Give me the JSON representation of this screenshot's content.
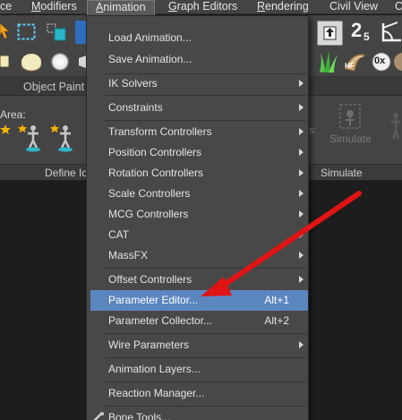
{
  "menubar": {
    "items": [
      {
        "label": "ce"
      },
      {
        "label": "Modifiers",
        "mnemonic": "M",
        "rest": "odifiers"
      },
      {
        "label": "Animation",
        "mnemonic": "A",
        "rest": "nimation"
      },
      {
        "label": "Graph Editors",
        "mnemonic": "G",
        "rest": "raph Editors"
      },
      {
        "label": "Rendering",
        "mnemonic": "R",
        "rest": "endering"
      },
      {
        "label": "Civil View"
      },
      {
        "label": "C"
      }
    ]
  },
  "toolbar": {
    "icons": [
      "arrow-cursor-icon",
      "dashed-select-region-icon",
      "teal-select-object-icon",
      "blue-toolbar-icon",
      "upload-arrow-icon",
      "snap-2-5-icon",
      "angle-snap-icon",
      "sphere-shape-icon",
      "cylinder-shape-icon",
      "grass-icon",
      "hair-fur-icon",
      "hf-icon",
      "zero-x-icon",
      "texture-ball-icon"
    ],
    "snap_label": "2",
    "snap_small": "5",
    "hf_label": "HF",
    "zero_x_label": "0x"
  },
  "ribbon": {
    "object_paint_label": "Object Paint",
    "area_label": "Area:",
    "simulate_button_label": "Simulate",
    "define_label": "Define Ic",
    "simulate_label": "Simulate",
    "ss_fragment": "s:",
    "colors": {
      "panel": "#444444",
      "footer": "#3b3b3b"
    }
  },
  "animation_menu": {
    "items": [
      {
        "label": "Load Animation..."
      },
      {
        "label": "Save Animation..."
      },
      {
        "label": "IK Solvers",
        "submenu": true
      },
      {
        "label": "Constraints",
        "submenu": true
      },
      {
        "label": "Transform Controllers",
        "submenu": true
      },
      {
        "label": "Position Controllers",
        "submenu": true
      },
      {
        "label": "Rotation Controllers",
        "submenu": true
      },
      {
        "label": "Scale Controllers",
        "submenu": true
      },
      {
        "label": "MCG Controllers",
        "submenu": true
      },
      {
        "label": "CAT",
        "submenu": true
      },
      {
        "label": "MassFX",
        "submenu": true
      },
      {
        "label": "Offset Controllers",
        "submenu": true
      },
      {
        "label": "Parameter Editor...",
        "shortcut": "Alt+1",
        "highlighted": true
      },
      {
        "label": "Parameter Collector...",
        "shortcut": "Alt+2"
      },
      {
        "label": "Wire Parameters",
        "submenu": true
      },
      {
        "label": "Animation Layers..."
      },
      {
        "label": "Reaction Manager..."
      },
      {
        "label": "Bone Tools..."
      }
    ],
    "highlight_color": "#5b86c0"
  },
  "annotation": {
    "arrow_color": "#e01414"
  }
}
